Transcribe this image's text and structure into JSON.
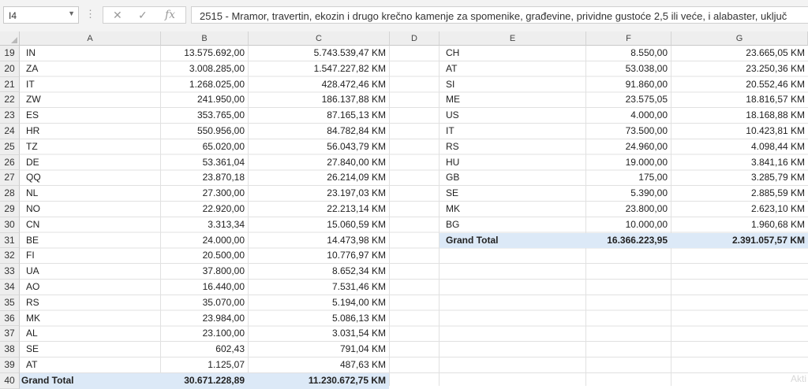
{
  "formula_bar": {
    "name_box": "I4",
    "cancel_icon": "close-icon",
    "enter_icon": "check-icon",
    "fx_label": "fx",
    "content": "2515 - Mramor, travertin, ekozin i drugo krečno kamenje za spomenike, građevine, prividne gustoće 2,5 ili veće, i alabaster, uključ"
  },
  "columns": [
    "A",
    "B",
    "C",
    "D",
    "E",
    "F",
    "G"
  ],
  "left_table": [
    {
      "row": "19",
      "country": "IN",
      "qty": "13.575.692,00",
      "value": "5.743.539,47 KM"
    },
    {
      "row": "20",
      "country": "ZA",
      "qty": "3.008.285,00",
      "value": "1.547.227,82 KM"
    },
    {
      "row": "21",
      "country": "IT",
      "qty": "1.268.025,00",
      "value": "428.472,46 KM"
    },
    {
      "row": "22",
      "country": "ZW",
      "qty": "241.950,00",
      "value": "186.137,88 KM"
    },
    {
      "row": "23",
      "country": "ES",
      "qty": "353.765,00",
      "value": "87.165,13 KM"
    },
    {
      "row": "24",
      "country": "HR",
      "qty": "550.956,00",
      "value": "84.782,84 KM"
    },
    {
      "row": "25",
      "country": "TZ",
      "qty": "65.020,00",
      "value": "56.043,79 KM"
    },
    {
      "row": "26",
      "country": "DE",
      "qty": "53.361,04",
      "value": "27.840,00 KM"
    },
    {
      "row": "27",
      "country": "QQ",
      "qty": "23.870,18",
      "value": "26.214,09 KM"
    },
    {
      "row": "28",
      "country": "NL",
      "qty": "27.300,00",
      "value": "23.197,03 KM"
    },
    {
      "row": "29",
      "country": "NO",
      "qty": "22.920,00",
      "value": "22.213,14 KM"
    },
    {
      "row": "30",
      "country": "CN",
      "qty": "3.313,34",
      "value": "15.060,59 KM"
    },
    {
      "row": "31",
      "country": "BE",
      "qty": "24.000,00",
      "value": "14.473,98 KM"
    },
    {
      "row": "32",
      "country": "FI",
      "qty": "20.500,00",
      "value": "10.776,97 KM"
    },
    {
      "row": "33",
      "country": "UA",
      "qty": "37.800,00",
      "value": "8.652,34 KM"
    },
    {
      "row": "34",
      "country": "AO",
      "qty": "16.440,00",
      "value": "7.531,46 KM"
    },
    {
      "row": "35",
      "country": "RS",
      "qty": "35.070,00",
      "value": "5.194,00 KM"
    },
    {
      "row": "36",
      "country": "MK",
      "qty": "23.984,00",
      "value": "5.086,13 KM"
    },
    {
      "row": "37",
      "country": "AL",
      "qty": "23.100,00",
      "value": "3.031,54 KM"
    },
    {
      "row": "38",
      "country": "SE",
      "qty": "602,43",
      "value": "791,04 KM"
    },
    {
      "row": "39",
      "country": "AT",
      "qty": "1.125,07",
      "value": "487,63 KM"
    }
  ],
  "left_total": {
    "row": "40",
    "label": "Grand Total",
    "qty": "30.671.228,89",
    "value": "11.230.672,75 KM"
  },
  "right_table": [
    {
      "country": "CH",
      "qty": "8.550,00",
      "value": "23.665,05 KM"
    },
    {
      "country": "AT",
      "qty": "53.038,00",
      "value": "23.250,36 KM"
    },
    {
      "country": "SI",
      "qty": "91.860,00",
      "value": "20.552,46 KM"
    },
    {
      "country": "ME",
      "qty": "23.575,05",
      "value": "18.816,57 KM"
    },
    {
      "country": "US",
      "qty": "4.000,00",
      "value": "18.168,88 KM"
    },
    {
      "country": "IT",
      "qty": "73.500,00",
      "value": "10.423,81 KM"
    },
    {
      "country": "RS",
      "qty": "24.960,00",
      "value": "4.098,44 KM"
    },
    {
      "country": "HU",
      "qty": "19.000,00",
      "value": "3.841,16 KM"
    },
    {
      "country": "GB",
      "qty": "175,00",
      "value": "3.285,79 KM"
    },
    {
      "country": "SE",
      "qty": "5.390,00",
      "value": "2.885,59 KM"
    },
    {
      "country": "MK",
      "qty": "23.800,00",
      "value": "2.623,10 KM"
    },
    {
      "country": "BG",
      "qty": "10.000,00",
      "value": "1.960,68 KM"
    }
  ],
  "right_total": {
    "label": "Grand Total",
    "qty": "16.366.223,95",
    "value": "2.391.057,57 KM"
  },
  "watermark": "Akti",
  "colors": {
    "total_highlight": "#dce9f7",
    "header_bg": "#eeeeee",
    "gridline": "#e1e1e1"
  }
}
